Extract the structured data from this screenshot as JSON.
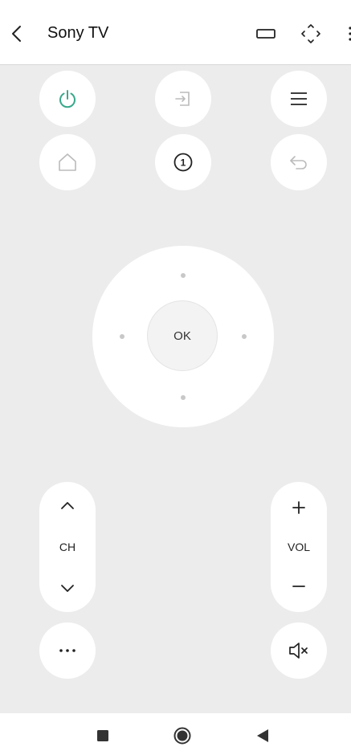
{
  "header": {
    "title": "Sony TV",
    "icons": [
      "back-arrow-icon",
      "screen-icon",
      "fullscreen-move-icon",
      "more-vert-icon"
    ]
  },
  "top_buttons": [
    "power-icon",
    "input-icon",
    "menu-icon",
    "home-icon",
    "number-1-icon",
    "return-icon"
  ],
  "dpad": {
    "ok_label": "OK"
  },
  "channel": {
    "label": "CH"
  },
  "volume": {
    "label": "VOL"
  },
  "bottom_buttons": [
    "more-dots-icon",
    "mute-icon"
  ],
  "navbar": [
    "recents-square-icon",
    "home-circle-icon",
    "back-triangle-icon"
  ],
  "colors": {
    "power_accent": "#3aa88c",
    "background": "#ececec",
    "button": "#ffffff"
  }
}
